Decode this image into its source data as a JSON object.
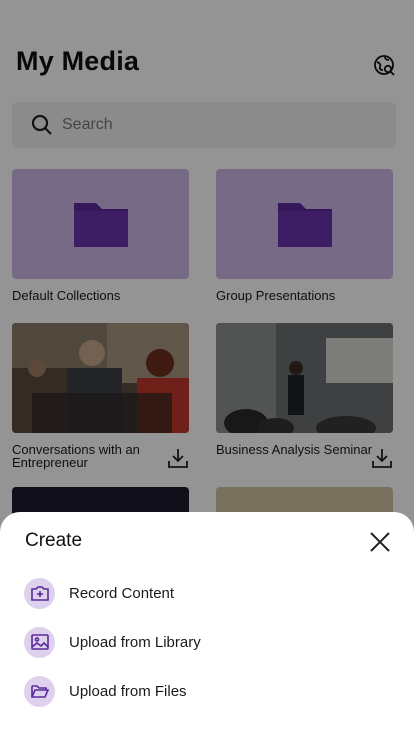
{
  "header": {
    "title": "My Media",
    "globe_icon": "globe-search-icon"
  },
  "search": {
    "placeholder": "Search"
  },
  "media": {
    "tiles": [
      {
        "label": "Default Collections",
        "kind": "folder"
      },
      {
        "label": "Group Presentations",
        "kind": "folder"
      },
      {
        "label": "Conversations with an Entrepreneur",
        "kind": "video"
      },
      {
        "label": "Business Analysis Seminar",
        "kind": "video"
      }
    ]
  },
  "sheet": {
    "title": "Create",
    "actions": [
      {
        "label": "Record Content",
        "icon": "camera-plus-icon"
      },
      {
        "label": "Upload from Library",
        "icon": "image-icon"
      },
      {
        "label": "Upload from Files",
        "icon": "folder-open-icon"
      }
    ]
  },
  "colors": {
    "folder_bg": "#cbb7e8",
    "folder_icon": "#5b2a99",
    "accent_soft": "#ddd1ee",
    "scrim": "rgba(0,0,0,0.42)"
  }
}
